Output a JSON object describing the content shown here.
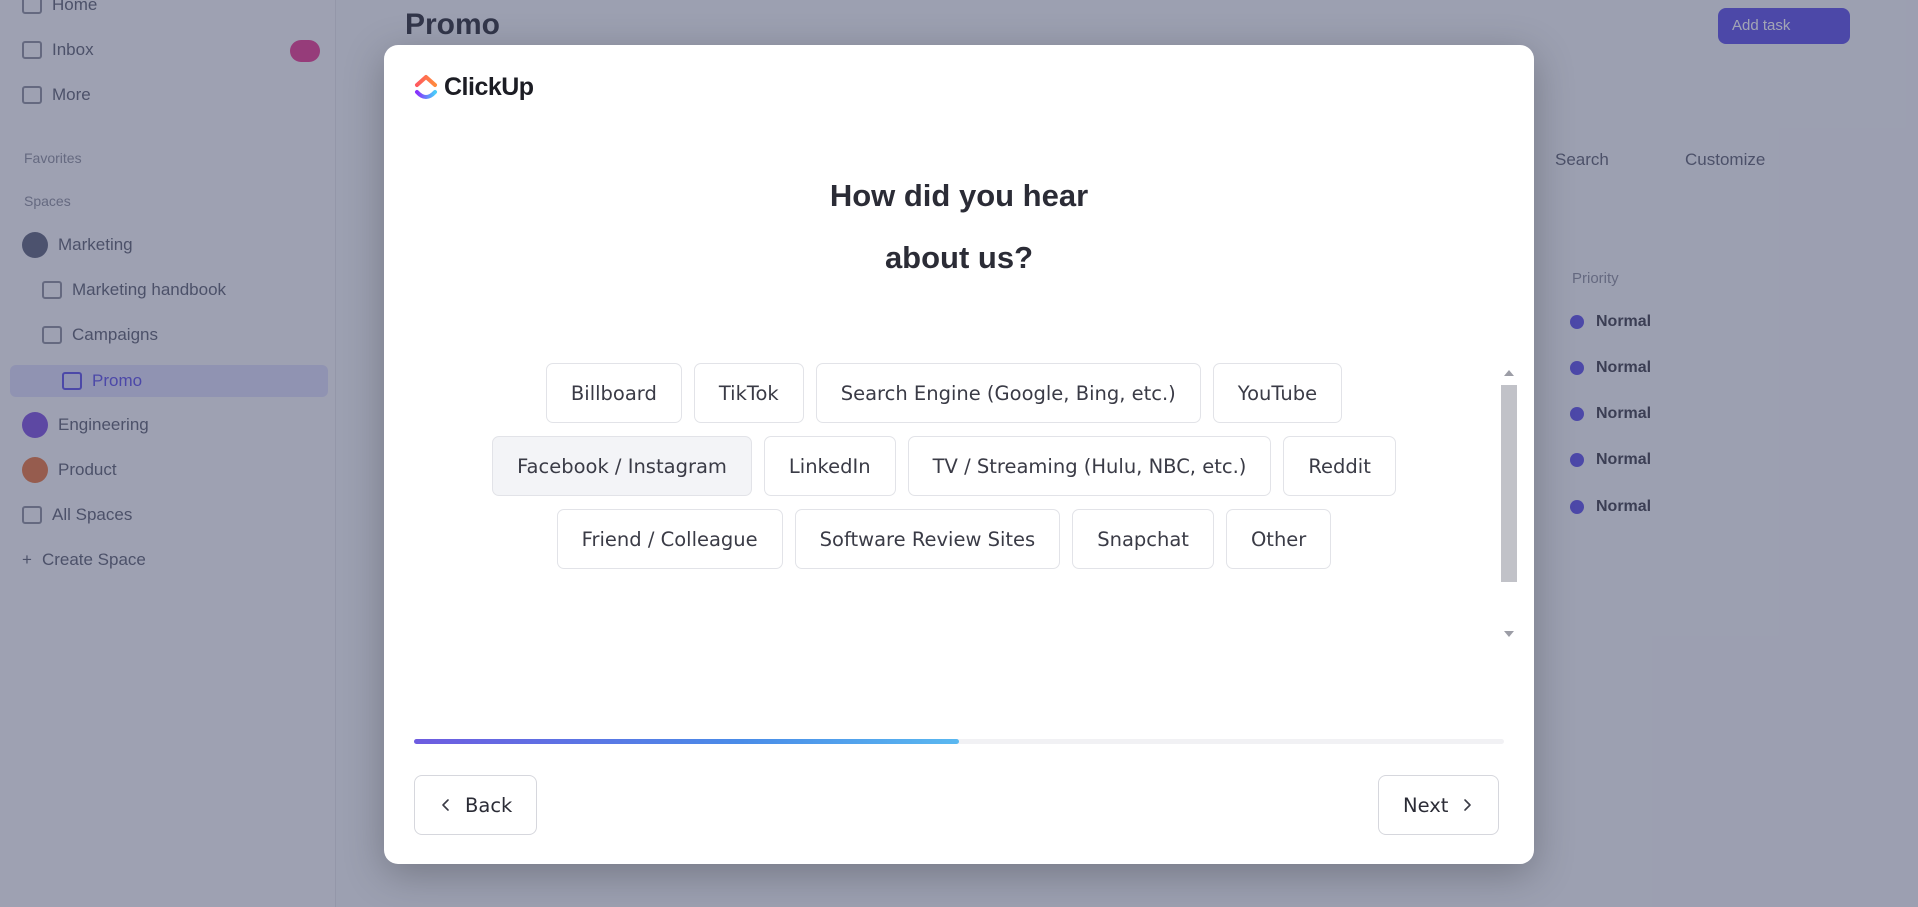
{
  "background": {
    "sidebar": {
      "items": [
        {
          "label": "Home",
          "icon": "home-icon"
        },
        {
          "label": "Inbox",
          "icon": "inbox-icon"
        },
        {
          "label": "More",
          "icon": "more-icon"
        }
      ],
      "favorites_heading": "Favorites",
      "spaces_heading": "Spaces",
      "spaces": [
        {
          "label": "Marketing",
          "color": "#5b6078"
        },
        {
          "label": "Marketing handbook"
        },
        {
          "label": "Campaigns"
        },
        {
          "label": "Promo"
        },
        {
          "label": "Engineering",
          "color": "#7c4ddc"
        },
        {
          "label": "Product",
          "color": "#e8743a"
        },
        {
          "label": "All Spaces"
        },
        {
          "label": "Create Space"
        }
      ]
    },
    "page_title": "Promo",
    "add_task_label": "Add task",
    "toolbar": {
      "search": "Search",
      "customize": "Customize"
    },
    "column_header": "Priority",
    "rows": [
      "Normal",
      "Normal",
      "Normal",
      "Normal",
      "Normal"
    ]
  },
  "modal": {
    "brand": "ClickUp",
    "question_line1": "How did you hear",
    "question_line2": "about us?",
    "options": [
      {
        "label": "Billboard",
        "selected": false
      },
      {
        "label": "TikTok",
        "selected": false
      },
      {
        "label": "Search Engine (Google, Bing, etc.)",
        "selected": false
      },
      {
        "label": "YouTube",
        "selected": false
      },
      {
        "label": "Facebook / Instagram",
        "selected": true
      },
      {
        "label": "LinkedIn",
        "selected": false
      },
      {
        "label": "TV / Streaming (Hulu, NBC, etc.)",
        "selected": false
      },
      {
        "label": "Reddit",
        "selected": false
      },
      {
        "label": "Friend / Colleague",
        "selected": false
      },
      {
        "label": "Software Review Sites",
        "selected": false
      },
      {
        "label": "Snapchat",
        "selected": false
      },
      {
        "label": "Other",
        "selected": false
      }
    ],
    "progress_fraction": 0.5,
    "back_label": "Back",
    "next_label": "Next"
  },
  "colors": {
    "accent": "#7b68ee",
    "progress_start": "#6e5ce0",
    "progress_end": "#5ab8f0"
  }
}
